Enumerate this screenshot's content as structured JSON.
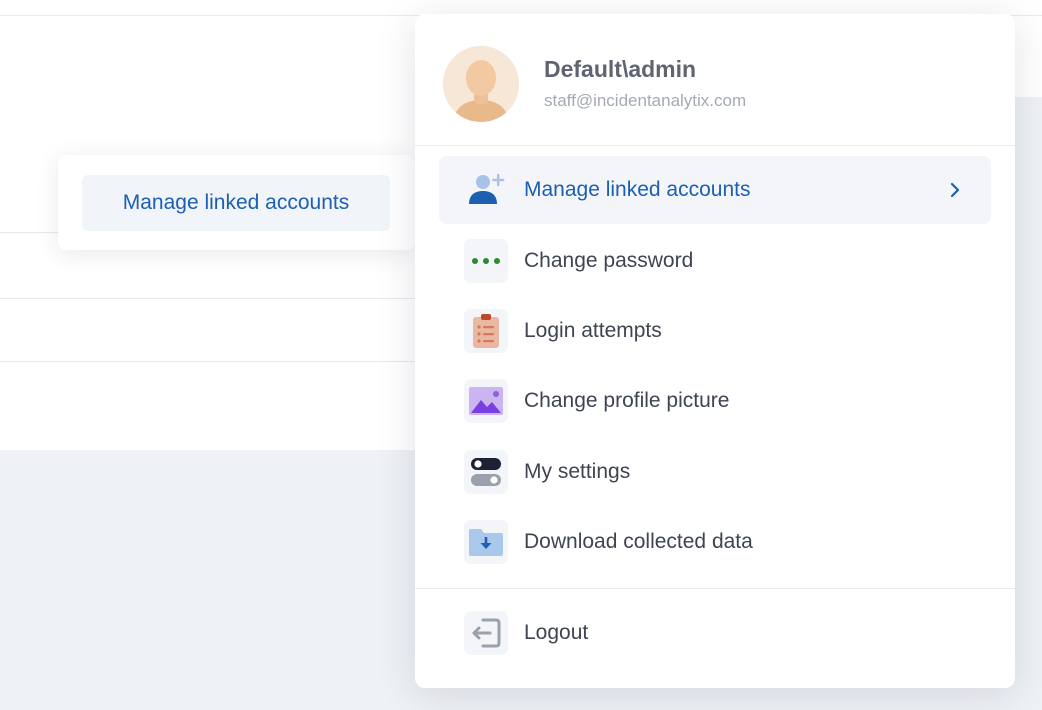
{
  "tooltip": {
    "label": "Manage linked accounts"
  },
  "user": {
    "name": "Default\\admin",
    "email": "staff@incidentanalytix.com",
    "avatar_icon": "user-avatar-icon"
  },
  "menu": {
    "items": [
      {
        "label": "Manage linked accounts",
        "icon": "user-plus-icon",
        "active": true
      },
      {
        "label": "Change password",
        "icon": "password-dots-icon"
      },
      {
        "label": "Login attempts",
        "icon": "clipboard-list-icon"
      },
      {
        "label": "Change profile picture",
        "icon": "image-icon"
      },
      {
        "label": "My settings",
        "icon": "toggle-settings-icon"
      },
      {
        "label": "Download collected data",
        "icon": "folder-download-icon"
      }
    ],
    "logout": {
      "label": "Logout",
      "icon": "logout-icon"
    }
  },
  "colors": {
    "accent": "#1d5fb0",
    "text": "#3f4550",
    "muted": "#a4a9b4"
  }
}
